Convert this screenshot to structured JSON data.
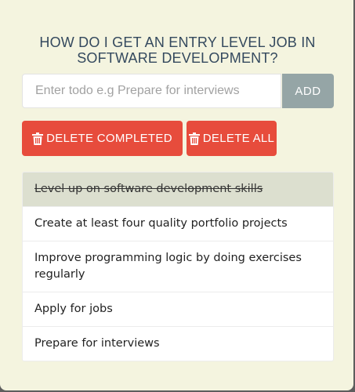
{
  "app": {
    "title_line1": "HOW DO I GET AN ENTRY LEVEL JOB IN",
    "title_line2": "SOFTWARE DEVELOPMENT?"
  },
  "input": {
    "placeholder": "Enter todo e.g Prepare for interviews",
    "value": ""
  },
  "buttons": {
    "add_label": "ADD",
    "delete_completed_label": "DELETE COMPLETED",
    "delete_all_label": "DELETE ALL",
    "danger_color": "#e74c3c",
    "add_color": "#95a5a6",
    "icon": "trash-icon"
  },
  "todos": [
    {
      "text": "Level up on software development skills",
      "completed": true
    },
    {
      "text": "Create at least four quality portfolio projects",
      "completed": false
    },
    {
      "text": "Improve programming logic by doing exercises regularly",
      "completed": false
    },
    {
      "text": "Apply for jobs",
      "completed": false
    },
    {
      "text": "Prepare for interviews",
      "completed": false
    }
  ]
}
